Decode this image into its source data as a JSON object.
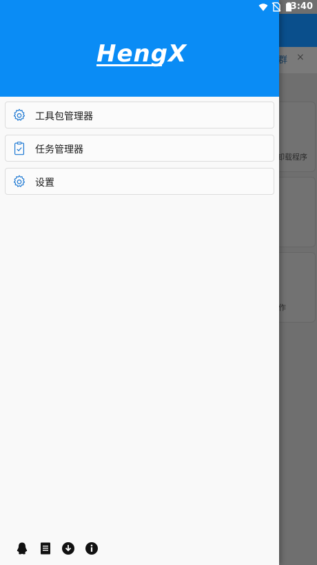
{
  "status_bar": {
    "time": "3:40"
  },
  "background": {
    "tab_label": "群",
    "tab_close": "×",
    "card_texts": [
      "卸载程序",
      "作"
    ]
  },
  "drawer": {
    "logo": "HengX",
    "menu": [
      {
        "label": "工具包管理器",
        "icon": "gear-icon"
      },
      {
        "label": "任务管理器",
        "icon": "clipboard-check-icon"
      },
      {
        "label": "设置",
        "icon": "gear-icon"
      }
    ],
    "bottom_icons": [
      "qq-icon",
      "document-icon",
      "download-icon",
      "info-icon"
    ]
  },
  "colors": {
    "header_blue": "#0a8cf5",
    "icon_blue": "#1976d2",
    "appbar_dim": "#0a4f8c"
  }
}
